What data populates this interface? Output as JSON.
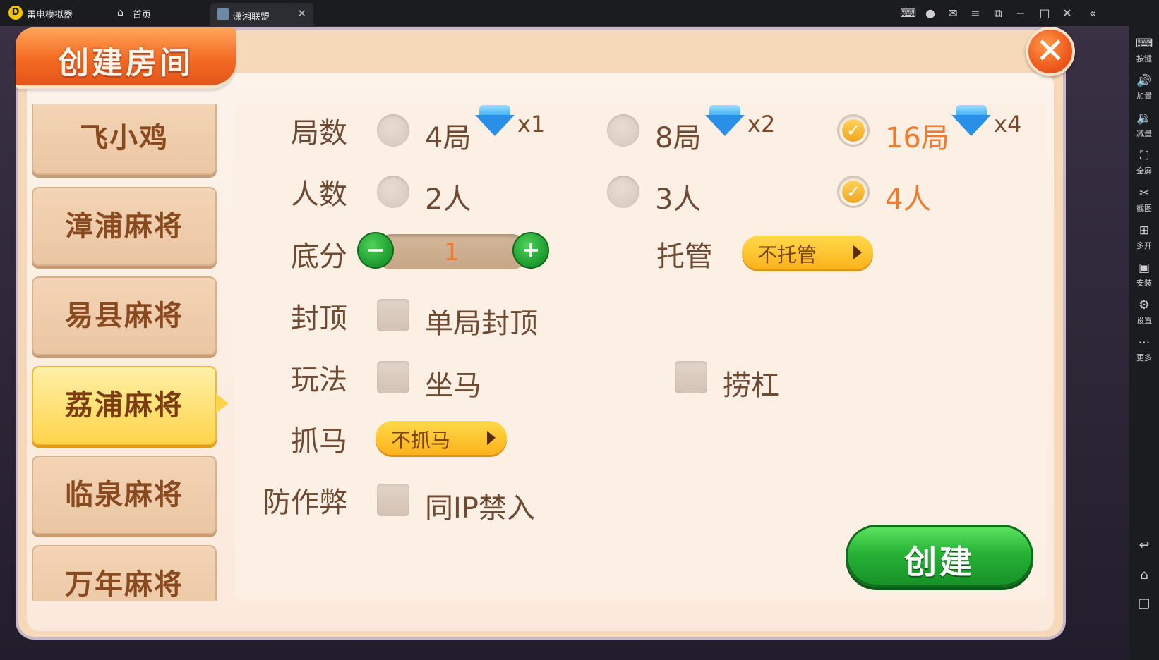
{
  "window": {
    "app_name": "雷电模拟器",
    "tabs": [
      {
        "label": "首页"
      },
      {
        "label": "潇湘联盟"
      }
    ]
  },
  "sidebar": {
    "items": [
      {
        "label": "按键",
        "icon": "keyboard-icon"
      },
      {
        "label": "加量",
        "icon": "volume-up-icon"
      },
      {
        "label": "减量",
        "icon": "volume-down-icon"
      },
      {
        "label": "全屏",
        "icon": "fullscreen-icon"
      },
      {
        "label": "截图",
        "icon": "scissors-icon"
      },
      {
        "label": "多开",
        "icon": "multi-instance-icon"
      },
      {
        "label": "安装",
        "icon": "apk-install-icon"
      },
      {
        "label": "设置",
        "icon": "gear-icon"
      },
      {
        "label": "更多",
        "icon": "more-icon"
      }
    ]
  },
  "dialog": {
    "title": "创建房间",
    "close_glyph": "✕",
    "games": [
      {
        "label": "飞小鸡"
      },
      {
        "label": "漳浦麻将"
      },
      {
        "label": "易县麻将"
      },
      {
        "label": "荔浦麻将",
        "active": true
      },
      {
        "label": "临泉麻将"
      },
      {
        "label": "万年麻将"
      }
    ],
    "rounds": {
      "label": "局数",
      "options": [
        {
          "text": "4局",
          "cost": "x1",
          "checked": false
        },
        {
          "text": "8局",
          "cost": "x2",
          "checked": false
        },
        {
          "text": "16局",
          "cost": "x4",
          "checked": true
        }
      ]
    },
    "players": {
      "label": "人数",
      "options": [
        {
          "text": "2人",
          "checked": false
        },
        {
          "text": "3人",
          "checked": false
        },
        {
          "text": "4人",
          "checked": true
        }
      ]
    },
    "base_score": {
      "label": "底分",
      "value": "1",
      "minus": "−",
      "plus": "+"
    },
    "trustee": {
      "label": "托管",
      "value": "不托管"
    },
    "cap": {
      "label": "封顶",
      "option": "单局封顶"
    },
    "play": {
      "label": "玩法",
      "options": [
        "坐马",
        "捞杠"
      ]
    },
    "grab_horse": {
      "label": "抓马",
      "value": "不抓马"
    },
    "anti_cheat": {
      "label": "防作弊",
      "option": "同IP禁入"
    },
    "create_label": "创建"
  }
}
